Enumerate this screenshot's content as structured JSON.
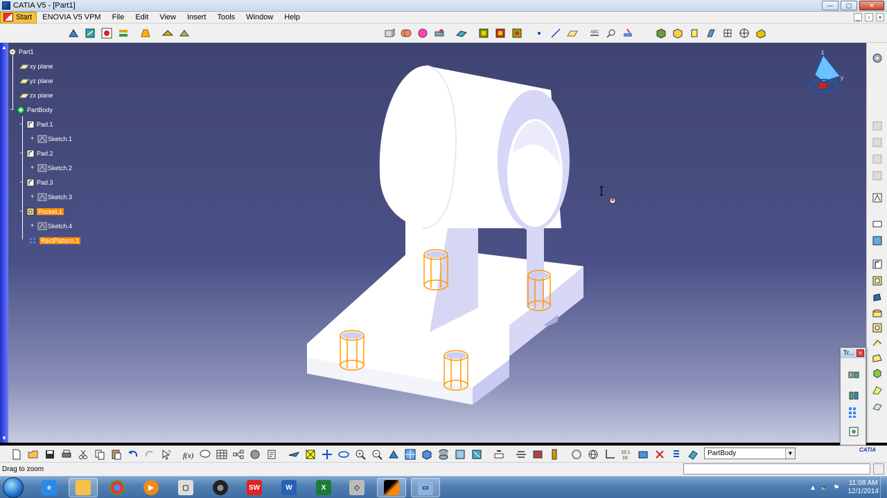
{
  "window": {
    "title": "CATIA V5 - [Part1]"
  },
  "menu": {
    "start": "Start",
    "items": [
      "ENOVIA V5 VPM",
      "File",
      "Edit",
      "View",
      "Insert",
      "Tools",
      "Window",
      "Help"
    ]
  },
  "tree": {
    "root": "Part1",
    "planes": [
      "xy plane",
      "yz plane",
      "zx plane"
    ],
    "body": "PartBody",
    "features": [
      {
        "label": "Pad.1",
        "sketch": "Sketch.1"
      },
      {
        "label": "Pad.2",
        "sketch": "Sketch.2"
      },
      {
        "label": "Pad.3",
        "sketch": "Sketch.3"
      },
      {
        "label": "Pocket.1",
        "sketch": "Sketch.4"
      }
    ],
    "pattern": "RectPattern.1"
  },
  "floating_toolbar": {
    "title": "Tr..."
  },
  "body_selector": {
    "value": "PartBody"
  },
  "logo": "CATIA",
  "status": {
    "message": "Drag to zoom"
  },
  "taskbar": {
    "apps": [
      "internet-explorer",
      "explorer",
      "chrome",
      "media-player",
      "file-manager",
      "network",
      "solidworks",
      "word",
      "excel",
      "vmware",
      "catia",
      "window"
    ],
    "clock": {
      "time": "11:08 AM",
      "date": "12/1/2014"
    }
  },
  "colors": {
    "viewport_top": "#3f4472",
    "viewport_bottom": "#c7cbe0",
    "selection": "#ff8c00",
    "highlight_edges": "#ff9a00"
  }
}
